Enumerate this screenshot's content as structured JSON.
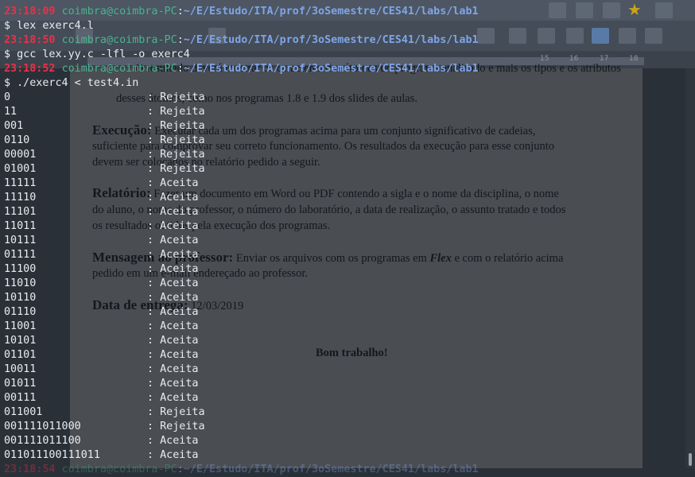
{
  "document": {
    "ruler_ticks": [
      "15",
      "16",
      "17",
      "18"
    ],
    "lines": {
      "intro1": "O resultado deverá mostrar os caracteres dos átomos do programa analisado e mais os tipos e os atributos",
      "intro2": "desses átomos, como nos programas 1.8 e 1.9 dos slides de aulas.",
      "exec_title": "Execução:",
      "exec1": "Executar cada um dos programas acima para um conjunto significativo de cadeias,",
      "exec2": "suficiente para comprovar seu correto funcionamento. Os resultados da execução para esse conjunto",
      "exec3": "devem ser colocados no relatório pedido a seguir.",
      "rel_title": "Relatório:",
      "rel1": "Fazer um documento em Word ou PDF contendo a sigla e o nome da disciplina, o nome",
      "rel2": "do aluno, o nome do professor, o número do laboratório, a data de realização, o assunto tratado e todos",
      "rel3": "os resultados obtidos pela execução dos programas.",
      "msg_title": "Mensagem ao professor:",
      "msg1a": "Enviar os arquivos com os programas em",
      "msg1b": "Flex",
      "msg1c": "e com o relatório acima",
      "msg2": "pedido em um e-mail endereçado ao professor.",
      "data_title": "Data de entrega:",
      "data_value": "12/03/2019",
      "bom": "Bom trabalho!"
    }
  },
  "terminal": {
    "prompt": {
      "user_host": "coimbra@coimbra-PC",
      "path": "~/E/Estudo/ITA/prof/3oSemestre/CES41/labs/lab1"
    },
    "sessions": [
      {
        "time": "23:18:09",
        "command": "$ lex exerc4.l"
      },
      {
        "time": "23:18:50",
        "command": "$ gcc lex.yy.c -lfl -o exerc4"
      },
      {
        "time": "23:18:52",
        "command": "$ ./exerc4 < test4.in"
      }
    ],
    "separator": ":",
    "results": [
      {
        "input": "0",
        "result": "Rejeita"
      },
      {
        "input": "11",
        "result": "Rejeita"
      },
      {
        "input": "001",
        "result": "Rejeita"
      },
      {
        "input": "0110",
        "result": "Rejeita"
      },
      {
        "input": "00001",
        "result": "Rejeita"
      },
      {
        "input": "01001",
        "result": "Rejeita"
      },
      {
        "input": "11111",
        "result": "Aceita"
      },
      {
        "input": "11110",
        "result": "Aceita"
      },
      {
        "input": "11101",
        "result": "Aceita"
      },
      {
        "input": "11011",
        "result": "Aceita"
      },
      {
        "input": "10111",
        "result": "Aceita"
      },
      {
        "input": "01111",
        "result": "Aceita"
      },
      {
        "input": "11100",
        "result": "Aceita"
      },
      {
        "input": "11010",
        "result": "Aceita"
      },
      {
        "input": "10110",
        "result": "Aceita"
      },
      {
        "input": "01110",
        "result": "Aceita"
      },
      {
        "input": "11001",
        "result": "Aceita"
      },
      {
        "input": "10101",
        "result": "Aceita"
      },
      {
        "input": "01101",
        "result": "Aceita"
      },
      {
        "input": "10011",
        "result": "Aceita"
      },
      {
        "input": "01011",
        "result": "Aceita"
      },
      {
        "input": "00111",
        "result": "Aceita"
      },
      {
        "input": "011001",
        "result": "Rejeita"
      },
      {
        "input": "001111011000",
        "result": "Rejeita"
      },
      {
        "input": "001111011100",
        "result": "Aceita"
      },
      {
        "input": "011011100111011",
        "result": "Aceita"
      }
    ],
    "last_prompt_time": "23:18:54"
  }
}
